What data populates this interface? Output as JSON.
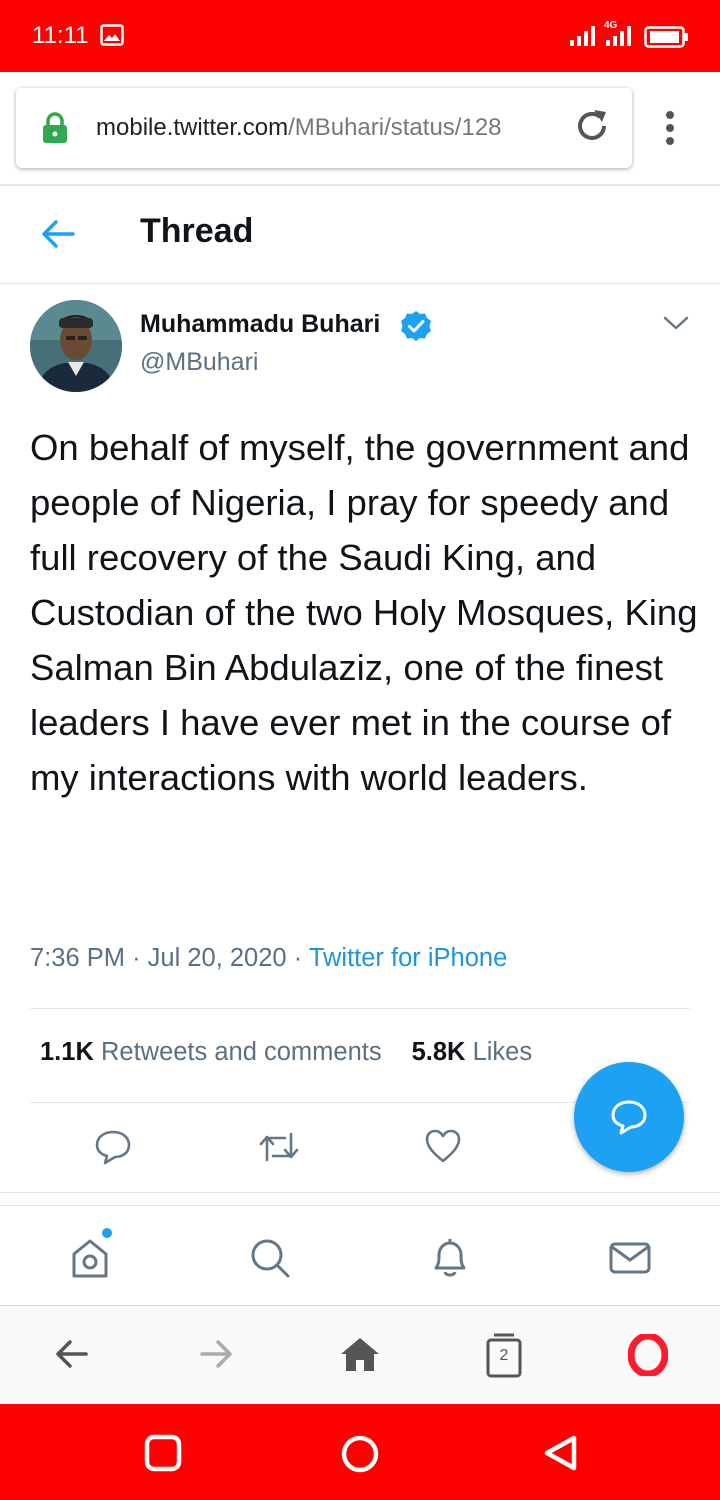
{
  "status_bar": {
    "time": "11:11",
    "network": "4G",
    "icons": [
      "gallery-icon",
      "signal-icon",
      "signal-icon",
      "battery-icon"
    ]
  },
  "browser": {
    "url_host": "mobile.twitter.com",
    "url_path": "/MBuhari/status/128",
    "tab_count": "2"
  },
  "header": {
    "title": "Thread"
  },
  "tweet": {
    "author_name": "Muhammadu Buhari",
    "handle": "@MBuhari",
    "text": "On behalf of myself, the government and people of Nigeria, I pray for speedy and full recovery of the Saudi King, and Custodian of the two Holy Mosques, King Salman Bin Abdulaziz, one of the finest leaders I have ever met in the course of my interactions with world leaders.",
    "time": "7:36 PM",
    "date": "Jul 20, 2020",
    "separator": "·",
    "source": "Twitter for iPhone",
    "retweets_count": "1.1K",
    "retweets_label": "Retweets and comments",
    "likes_count": "5.8K",
    "likes_label": "Likes"
  },
  "colors": {
    "accent": "#1da1f2",
    "status_bar": "#ff0000",
    "text_secondary": "#5b7083",
    "link": "#1b95e0",
    "opera": "#ff1b2d"
  }
}
